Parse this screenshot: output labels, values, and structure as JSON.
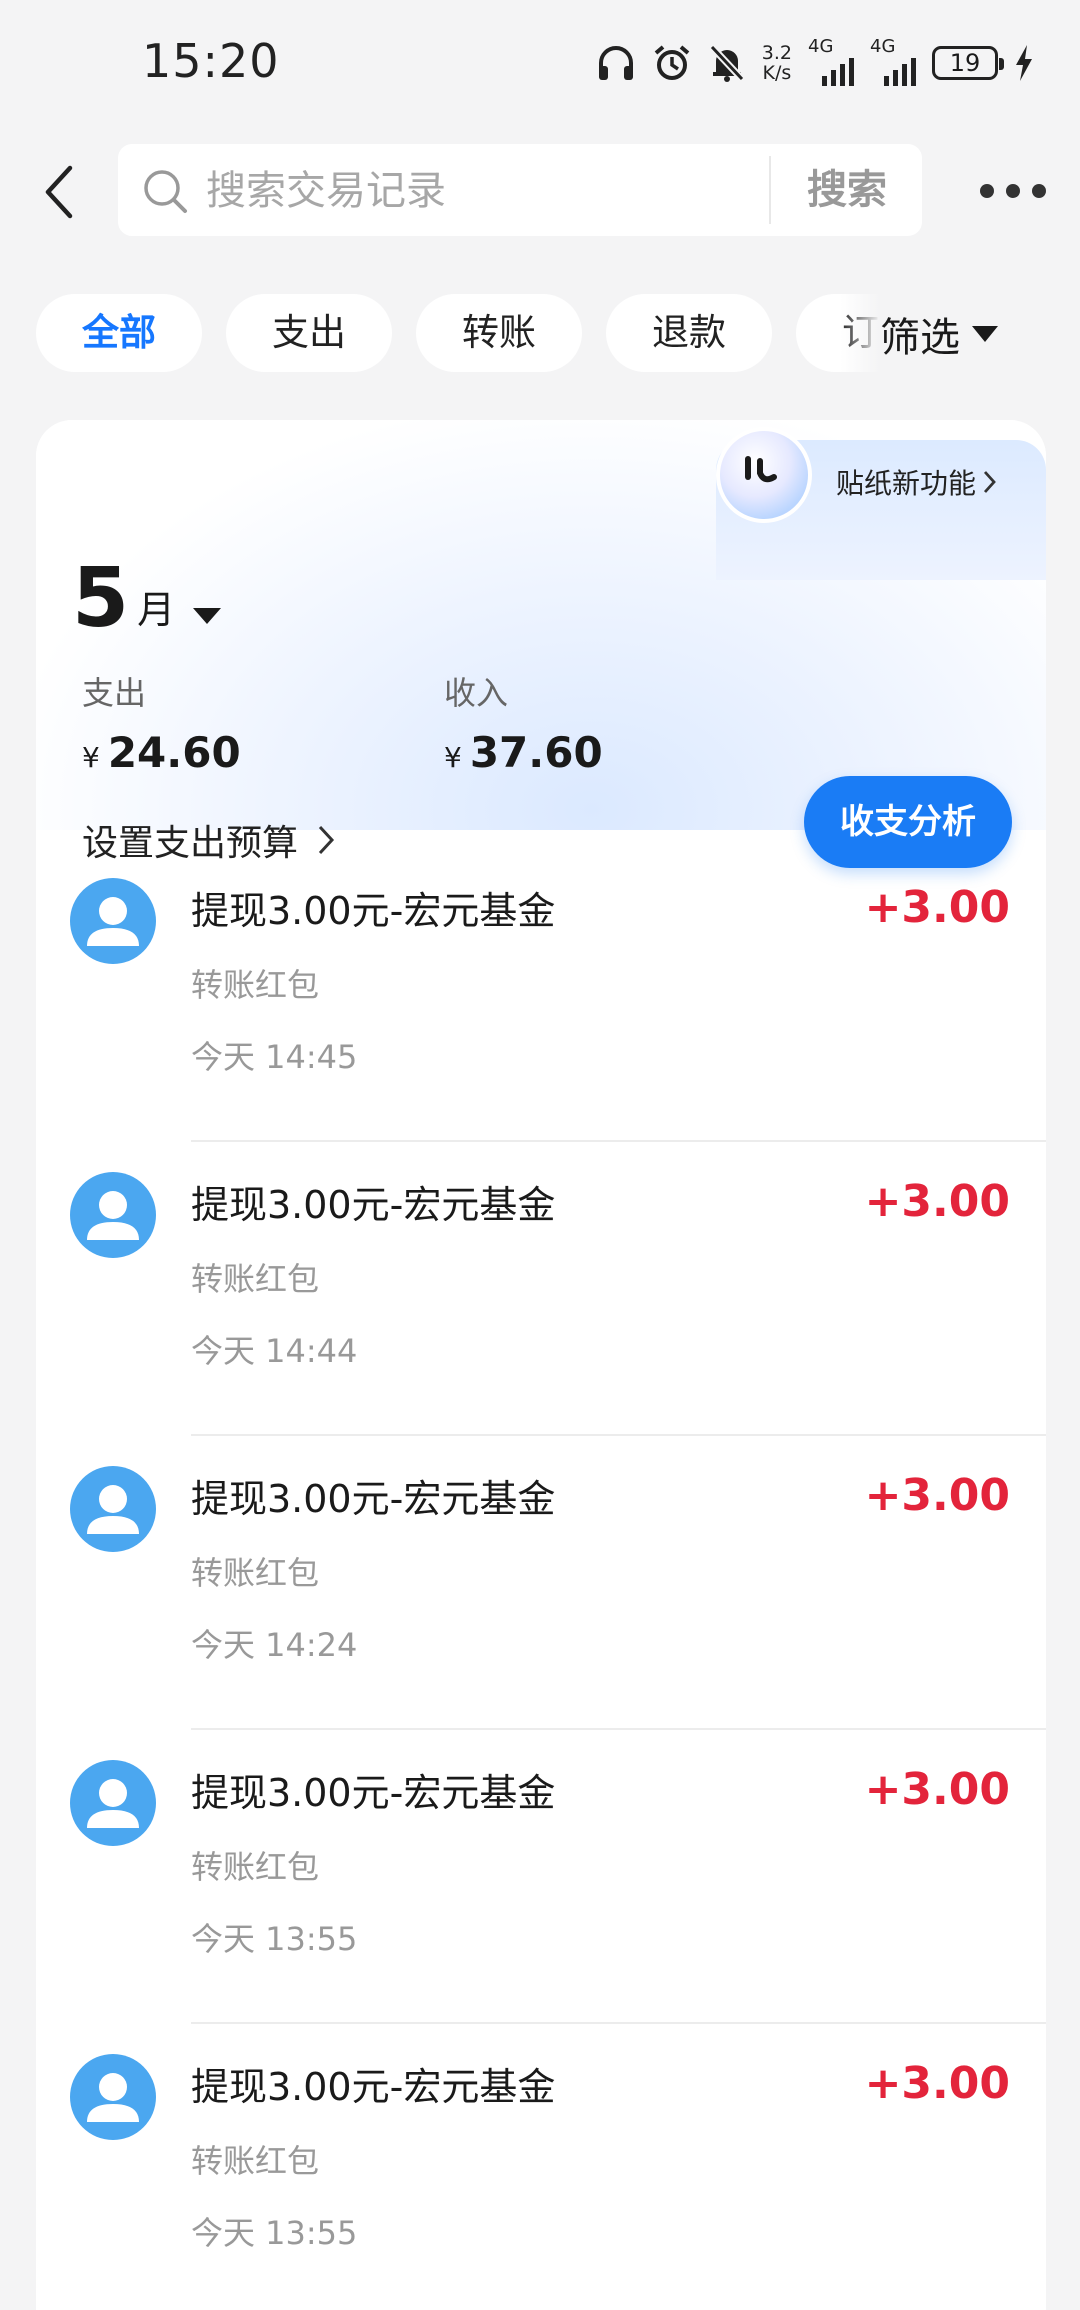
{
  "status_bar": {
    "time": "15:20",
    "net_speed_value": "3.2",
    "net_speed_unit": "K/s",
    "sim1_label": "4G",
    "sim2_label": "4G",
    "battery": "19",
    "icons": [
      "headphones-icon",
      "alarm-icon",
      "mute-bell-icon",
      "charging-bolt-icon"
    ]
  },
  "header": {
    "search_placeholder": "搜索交易记录",
    "search_button": "搜索"
  },
  "tabs": {
    "items": [
      {
        "label": "全部",
        "active": true
      },
      {
        "label": "支出",
        "active": false
      },
      {
        "label": "转账",
        "active": false
      },
      {
        "label": "退款",
        "active": false
      },
      {
        "label": "订单",
        "active": false
      }
    ],
    "filter_label": "筛选"
  },
  "summary": {
    "sticker_label": "贴纸新功能",
    "month_number": "5",
    "month_unit": "月",
    "expense_label": "支出",
    "expense_currency": "¥",
    "expense_value": "24.60",
    "income_label": "收入",
    "income_currency": "¥",
    "income_value": "37.60",
    "budget_label": "设置支出预算",
    "analyze_button": "收支分析"
  },
  "transactions": [
    {
      "title": "提现3.00元-宏元基金",
      "category": "转账红包",
      "time": "今天 14:45",
      "amount": "+3.00"
    },
    {
      "title": "提现3.00元-宏元基金",
      "category": "转账红包",
      "time": "今天 14:44",
      "amount": "+3.00"
    },
    {
      "title": "提现3.00元-宏元基金",
      "category": "转账红包",
      "time": "今天 14:24",
      "amount": "+3.00"
    },
    {
      "title": "提现3.00元-宏元基金",
      "category": "转账红包",
      "time": "今天 13:55",
      "amount": "+3.00"
    },
    {
      "title": "提现3.00元-宏元基金",
      "category": "转账红包",
      "time": "今天 13:55",
      "amount": "+3.00"
    }
  ],
  "colors": {
    "accent": "#1677ff",
    "income_amount": "#e3243b",
    "avatar": "#4ba7f0"
  }
}
